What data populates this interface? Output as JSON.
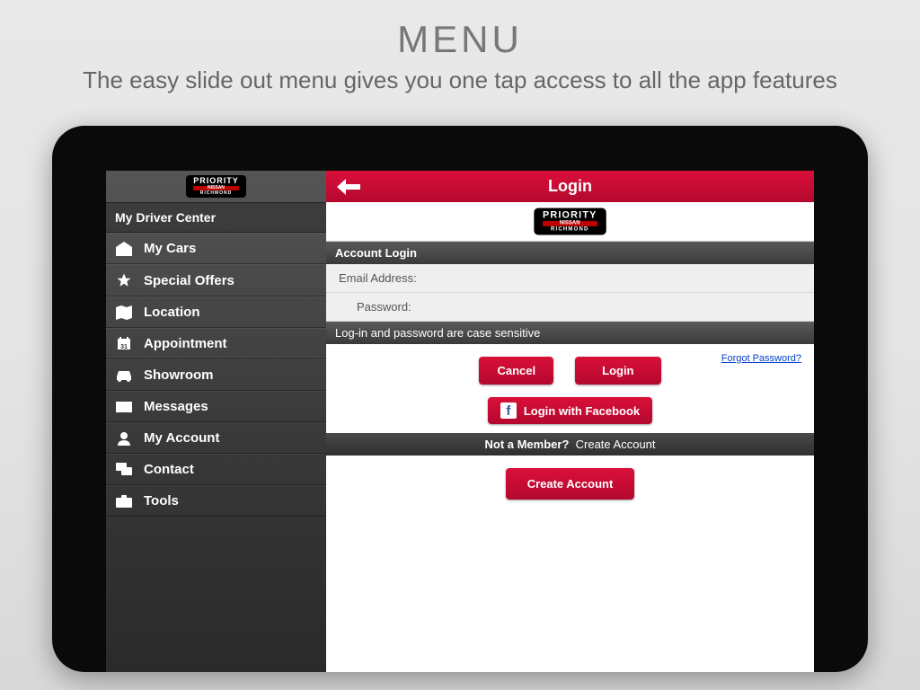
{
  "page": {
    "title": "MENU",
    "subtitle": "The easy slide out menu gives you one tap access to all the app features"
  },
  "logo": {
    "line1": "PRIORITY",
    "line2": "NISSAN",
    "line3": "RICHMOND"
  },
  "sidebar": {
    "header": "My Driver Center",
    "items": [
      {
        "label": "My Cars",
        "icon": "garage"
      },
      {
        "label": "Special Offers",
        "icon": "star"
      },
      {
        "label": "Location",
        "icon": "map"
      },
      {
        "label": "Appointment",
        "icon": "calendar"
      },
      {
        "label": "Showroom",
        "icon": "car"
      },
      {
        "label": "Messages",
        "icon": "envelope"
      },
      {
        "label": "My Account",
        "icon": "person"
      },
      {
        "label": "Contact",
        "icon": "speech"
      },
      {
        "label": "Tools",
        "icon": "briefcase"
      }
    ]
  },
  "login": {
    "title": "Login",
    "section": "Account Login",
    "email_label": "Email Address:",
    "password_label": "Password:",
    "note": "Log-in and password are case sensitive",
    "cancel": "Cancel",
    "login_btn": "Login",
    "forgot": "Forgot Password?",
    "fb": "Login with Facebook",
    "member_q": "Not a Member?",
    "member_link": "Create Account",
    "create": "Create Account"
  },
  "colors": {
    "accent": "#c40e35"
  }
}
